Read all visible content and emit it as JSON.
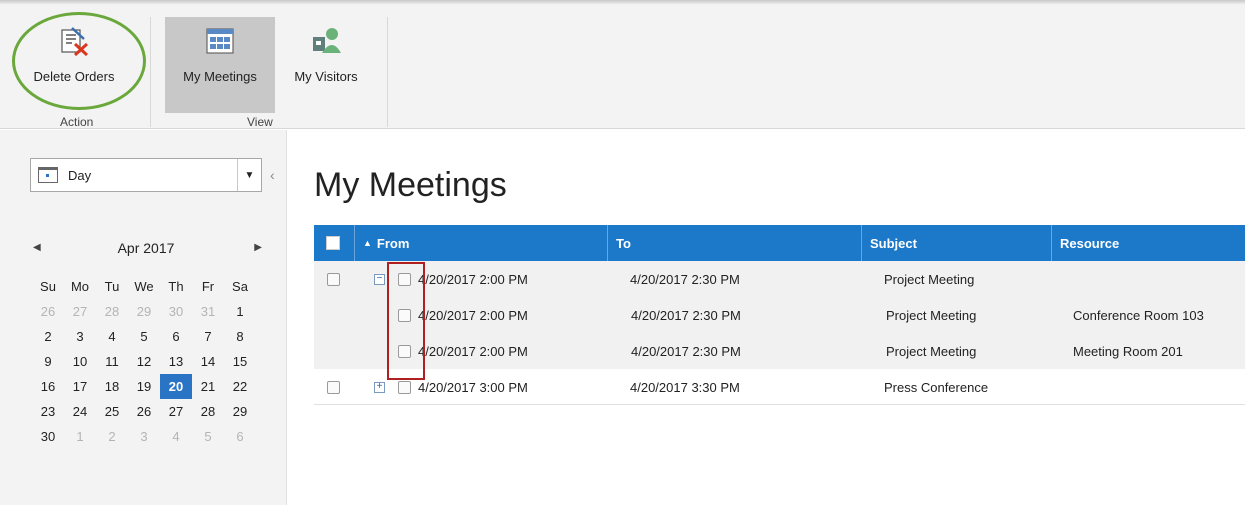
{
  "ribbon": {
    "buttons": [
      {
        "label": "Delete Orders",
        "icon": "delete-orders-icon"
      },
      {
        "label": "My Meetings",
        "icon": "my-meetings-icon"
      },
      {
        "label": "My Visitors",
        "icon": "my-visitors-icon"
      }
    ],
    "groups": [
      "Action",
      "View"
    ]
  },
  "sidebar": {
    "view_select": "Day",
    "calendar": {
      "month": "Apr 2017",
      "weekdays": [
        "Su",
        "Mo",
        "Tu",
        "We",
        "Th",
        "Fr",
        "Sa"
      ],
      "days": [
        "26",
        "27",
        "28",
        "29",
        "30",
        "31",
        "1",
        "2",
        "3",
        "4",
        "5",
        "6",
        "7",
        "8",
        "9",
        "10",
        "11",
        "12",
        "13",
        "14",
        "15",
        "16",
        "17",
        "18",
        "19",
        "20",
        "21",
        "22",
        "23",
        "24",
        "25",
        "26",
        "27",
        "28",
        "29",
        "30",
        "1",
        "2",
        "3",
        "4",
        "5",
        "6"
      ],
      "selected": "20"
    }
  },
  "main": {
    "title": "My Meetings",
    "columns": [
      "From",
      "To",
      "Subject",
      "Resource"
    ],
    "sort_glyph": "▲",
    "rows": [
      {
        "from": "4/20/2017 2:00 PM",
        "to": "4/20/2017 2:30 PM",
        "subject": "Project Meeting",
        "resource": ""
      },
      {
        "from": "4/20/2017 2:00 PM",
        "to": "4/20/2017 2:30 PM",
        "subject": "Project Meeting",
        "resource": "Conference Room 103"
      },
      {
        "from": "4/20/2017 2:00 PM",
        "to": "4/20/2017 2:30 PM",
        "subject": "Project Meeting",
        "resource": "Meeting Room 201"
      },
      {
        "from": "4/20/2017 3:00 PM",
        "to": "4/20/2017 3:30 PM",
        "subject": "Press Conference",
        "resource": ""
      }
    ]
  },
  "colors": {
    "accent": "#1c78c8",
    "selected_day": "#2a74c6",
    "highlight_ellipse": "#6aa83c",
    "highlight_box": "#b02020"
  }
}
